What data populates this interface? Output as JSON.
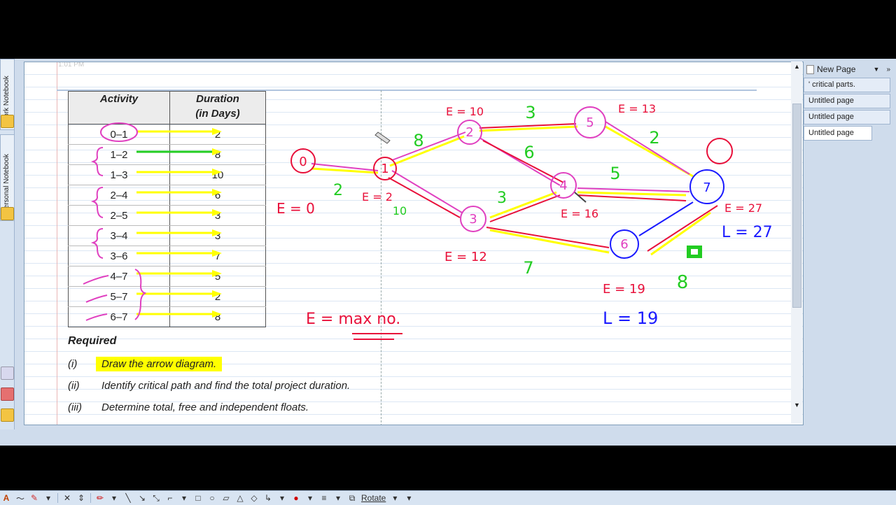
{
  "window": {
    "timestamp": "1:01 PM"
  },
  "notebooks": [
    {
      "label": "Work Notebook"
    },
    {
      "label": "Personal Notebook"
    }
  ],
  "table": {
    "headers": {
      "activity": "Activity",
      "duration_line1": "Duration",
      "duration_line2": "(in Days)"
    },
    "rows": [
      {
        "activity": "0–1",
        "duration": "2"
      },
      {
        "activity": "1–2",
        "duration": "8"
      },
      {
        "activity": "1–3",
        "duration": "10"
      },
      {
        "activity": "2–4",
        "duration": "6"
      },
      {
        "activity": "2–5",
        "duration": "3"
      },
      {
        "activity": "3–4",
        "duration": "3"
      },
      {
        "activity": "3–6",
        "duration": "7"
      },
      {
        "activity": "4–7",
        "duration": "5"
      },
      {
        "activity": "5–7",
        "duration": "2"
      },
      {
        "activity": "6–7",
        "duration": "8"
      }
    ]
  },
  "required": {
    "title": "Required",
    "items": [
      {
        "num": "(i)",
        "text": "Draw the arrow diagram."
      },
      {
        "num": "(ii)",
        "text": "Identify critical path and find the total project duration."
      },
      {
        "num": "(iii)",
        "text": "Determine total, free and independent floats."
      }
    ]
  },
  "handwriting": {
    "nodes": [
      "0",
      "1",
      "2",
      "3",
      "4",
      "5",
      "6",
      "7"
    ],
    "edge_labels": [
      "2",
      "8",
      "10",
      "3",
      "6",
      "3",
      "5",
      "2",
      "7",
      "8"
    ],
    "annotations": [
      "E = 0",
      "E = 2",
      "E = 10",
      "E = 13",
      "E = 12",
      "E = 16",
      "E = 19",
      "L = 19",
      "E = 27",
      "L = 27",
      "E = max no."
    ]
  },
  "page_list": {
    "new_page": "New Page",
    "pages": [
      "' critical parts.",
      "Untitled page",
      "Untitled page",
      "Untitled page"
    ]
  },
  "toolbar": {
    "rotate": "Rotate"
  },
  "colors": {
    "pen_red": "#e8103a",
    "pen_pink": "#e040c0",
    "pen_green": "#22cc22",
    "pen_blue": "#1a1aff",
    "highlight": "#ffff00"
  }
}
